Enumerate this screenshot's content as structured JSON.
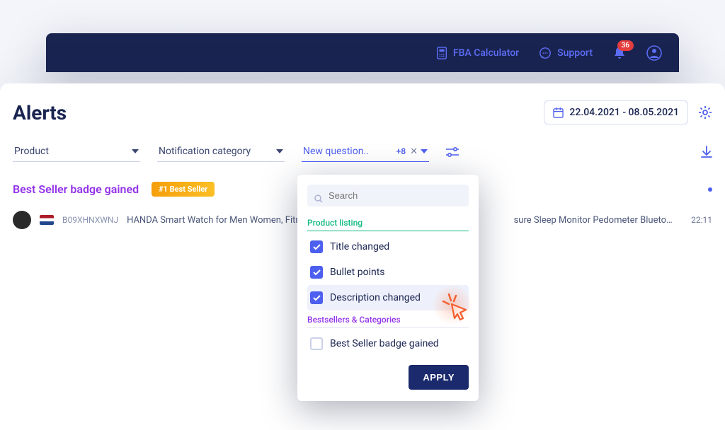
{
  "topbar": {
    "fba_label": "FBA Calculator",
    "support_label": "Support",
    "notif_count": "36"
  },
  "page": {
    "title": "Alerts",
    "date_range": "22.04.2021 - 08.05.2021"
  },
  "filters": {
    "product_label": "Product",
    "category_label": "Notification category",
    "question_label": "New question..",
    "question_count": "+8"
  },
  "dropdown": {
    "search_placeholder": "Search",
    "group1_label": "Product listing",
    "opt1_label": "Title changed",
    "opt2_label": "Bullet points",
    "opt3_label": "Description changed",
    "group2_label": "Bestsellers & Categories",
    "opt4_label": "Best Seller badge gained",
    "apply_label": "APPLY"
  },
  "row": {
    "title": "Best Seller badge gained",
    "badge": "#1 Best Seller",
    "asin": "B09XHNXWNJ",
    "product_left": "HANDA Smart Watch for Men Women, Fitness T",
    "product_right": "sure Sleep Monitor Pedometer Bluetooth IP68 ...",
    "time": "22:11"
  }
}
